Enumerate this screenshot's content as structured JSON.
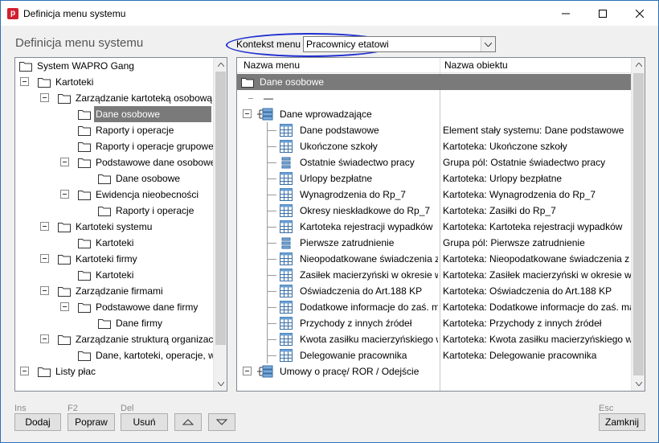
{
  "window": {
    "title": "Definicja menu systemu"
  },
  "page": {
    "heading": "Definicja menu systemu"
  },
  "context": {
    "label": "Kontekst menu",
    "value": "Pracownicy etatowi"
  },
  "left_tree": [
    {
      "text": "System WAPRO Gang",
      "level": 0,
      "toggle": false
    },
    {
      "text": "Kartoteki",
      "level": 1,
      "toggle": true
    },
    {
      "text": "Zarządzanie kartoteką osobową",
      "level": 2,
      "toggle": true
    },
    {
      "text": "Dane osobowe",
      "level": 3,
      "toggle": false,
      "selected": true
    },
    {
      "text": "Raporty i operacje",
      "level": 3,
      "toggle": false
    },
    {
      "text": "Raporty i operacje grupowe",
      "level": 3,
      "toggle": false
    },
    {
      "text": "Podstawowe dane osobowe",
      "level": 3,
      "toggle": true
    },
    {
      "text": "Dane osobowe",
      "level": 4,
      "toggle": false
    },
    {
      "text": "Ewidencja nieobecności",
      "level": 3,
      "toggle": true
    },
    {
      "text": "Raporty i operacje",
      "level": 4,
      "toggle": false
    },
    {
      "text": "Kartoteki systemu",
      "level": 2,
      "toggle": true
    },
    {
      "text": "Kartoteki",
      "level": 3,
      "toggle": false
    },
    {
      "text": "Kartoteki firmy",
      "level": 2,
      "toggle": true
    },
    {
      "text": "Kartoteki",
      "level": 3,
      "toggle": false
    },
    {
      "text": "Zarządzanie firmami",
      "level": 2,
      "toggle": true
    },
    {
      "text": "Podstawowe dane firmy",
      "level": 3,
      "toggle": true
    },
    {
      "text": "Dane firmy",
      "level": 4,
      "toggle": false
    },
    {
      "text": "Zarządzanie strukturą organizacyjną",
      "level": 2,
      "toggle": true
    },
    {
      "text": "Dane, kartoteki, operacje, wydruki",
      "level": 3,
      "toggle": false
    },
    {
      "text": "Listy płac",
      "level": 1,
      "toggle": true
    }
  ],
  "right_grid": {
    "columns": [
      "Nazwa menu",
      "Nazwa obiektu"
    ],
    "rows": [
      {
        "menu": "Dane osobowe",
        "object": "",
        "icon": "folder",
        "indent": 0,
        "selected": true
      },
      {
        "menu": "—",
        "object": "",
        "icon": "separator",
        "indent": 0
      },
      {
        "menu": "Dane wprowadzające",
        "object": "",
        "icon": "tree",
        "indent": 0,
        "toggle": true
      },
      {
        "menu": "Dane podstawowe",
        "object": "Element stały systemu: Dane podstawowe",
        "icon": "table",
        "indent": 1
      },
      {
        "menu": "Ukończone szkoły",
        "object": "Kartoteka: Ukończone szkoły",
        "icon": "table",
        "indent": 1
      },
      {
        "menu": "Ostatnie świadectwo pracy",
        "object": "Grupa pól: Ostatnie świadectwo pracy",
        "icon": "fields",
        "indent": 1
      },
      {
        "menu": "Urlopy bezpłatne",
        "object": "Kartoteka: Urlopy bezpłatne",
        "icon": "table",
        "indent": 1
      },
      {
        "menu": "Wynagrodzenia do Rp_7",
        "object": "Kartoteka: Wynagrodzenia do Rp_7",
        "icon": "table",
        "indent": 1
      },
      {
        "menu": "Okresy nieskładkowe do Rp_7",
        "object": "Kartoteka: Zasiłki do Rp_7",
        "icon": "table",
        "indent": 1
      },
      {
        "menu": "Kartoteka rejestracji wypadków",
        "object": "Kartoteka: Kartoteka rejestracji wypadków",
        "icon": "table",
        "indent": 1
      },
      {
        "menu": "Pierwsze zatrudnienie",
        "object": "Grupa pól: Pierwsze zatrudnienie",
        "icon": "fields",
        "indent": 1
      },
      {
        "menu": "Nieopodatkowane świadczenia z ZFŚS",
        "object": "Kartoteka: Nieopodatkowane świadczenia z ZFŚS",
        "icon": "table",
        "indent": 1
      },
      {
        "menu": "Zasiłek macierzyński w okresie wychowawczym",
        "object": "Kartoteka: Zasiłek macierzyński w okresie wychowawczym",
        "icon": "table",
        "indent": 1
      },
      {
        "menu": "Oświadczenia do Art.188 KP",
        "object": "Kartoteka: Oświadczenia do Art.188 KP",
        "icon": "table",
        "indent": 1
      },
      {
        "menu": "Dodatkowe informacje do zaś. macierzyńskiego",
        "object": "Kartoteka: Dodatkowe informacje do zaś. macierzyńskiego",
        "icon": "table",
        "indent": 1
      },
      {
        "menu": "Przychody z innych źródeł",
        "object": "Kartoteka: Przychody z innych źródeł",
        "icon": "table",
        "indent": 1
      },
      {
        "menu": "Kwota zasiłku macierzyńskiego wypłaconego",
        "object": "Kartoteka: Kwota zasiłku macierzyńskiego wypłaconego",
        "icon": "table",
        "indent": 1
      },
      {
        "menu": "Delegowanie pracownika",
        "object": "Kartoteka: Delegowanie pracownika",
        "icon": "table",
        "indent": 1
      },
      {
        "menu": "Umowy o pracę/ ROR / Odejście",
        "object": "",
        "icon": "tree",
        "indent": 0,
        "toggle": true
      }
    ]
  },
  "buttons": {
    "add": {
      "label": "Dodaj",
      "hotkey": "Ins"
    },
    "edit": {
      "label": "Popraw",
      "hotkey": "F2"
    },
    "delete": {
      "label": "Usuń",
      "hotkey": "Del"
    },
    "close": {
      "label": "Zamknij",
      "hotkey": "Esc"
    }
  },
  "colors": {
    "accent": "#1f2fd0",
    "selection": "#7a7a7a",
    "app_icon": "#d1202f"
  }
}
